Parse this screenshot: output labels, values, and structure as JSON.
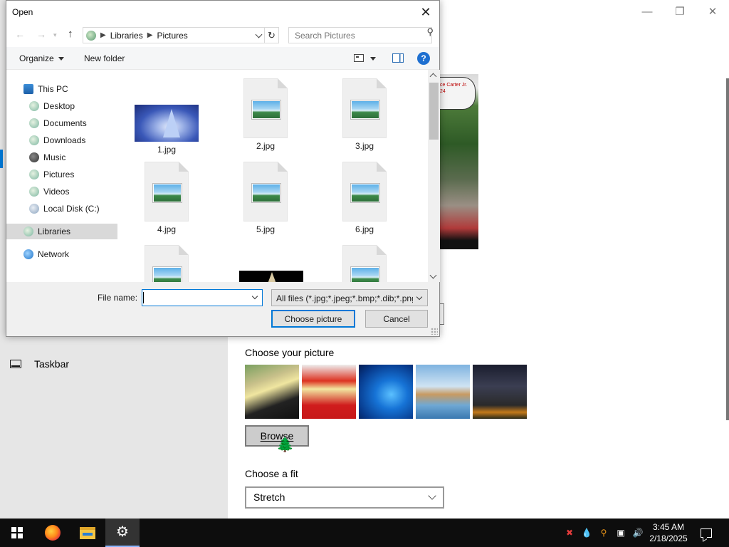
{
  "settings": {
    "nav": {
      "taskbar_label": "Taskbar"
    },
    "window_controls": {
      "minimize": "—",
      "restore": "❐",
      "close": "✕"
    },
    "preview_caption": "ce Carter Jr. 24",
    "choose_picture_title": "Choose your picture",
    "browse_label": "Browse",
    "choose_fit_title": "Choose a fit",
    "fit_value": "Stretch"
  },
  "dialog": {
    "title": "Open",
    "breadcrumb": [
      "Libraries",
      "Pictures"
    ],
    "search_placeholder": "Search Pictures",
    "commands": {
      "organize": "Organize",
      "new_folder": "New folder"
    },
    "nav_items": [
      {
        "label": "This PC",
        "icon": "pc-icon"
      },
      {
        "label": "Desktop",
        "icon": "library-icon"
      },
      {
        "label": "Documents",
        "icon": "library-icon"
      },
      {
        "label": "Downloads",
        "icon": "library-icon"
      },
      {
        "label": "Music",
        "icon": "music-icon"
      },
      {
        "label": "Pictures",
        "icon": "library-icon"
      },
      {
        "label": "Videos",
        "icon": "library-icon"
      },
      {
        "label": "Local Disk (C:)",
        "icon": "disk-icon"
      },
      {
        "label": "Libraries",
        "icon": "library-icon",
        "selected": true
      },
      {
        "label": "Network",
        "icon": "network-icon"
      }
    ],
    "files": [
      "1.jpg",
      "2.jpg",
      "3.jpg",
      "4.jpg",
      "5.jpg",
      "6.jpg"
    ],
    "file_name_label": "File name:",
    "file_name_value": "",
    "file_type_filter": "All files (*.jpg;*.jpeg;*.bmp;*.dib;*.png",
    "choose_button": "Choose picture",
    "cancel_button": "Cancel"
  },
  "taskbar": {
    "clock_time": "3:45 AM",
    "clock_date": "2/18/2025",
    "pinned": [
      "start-button",
      "firefox",
      "file-explorer",
      "settings"
    ]
  }
}
